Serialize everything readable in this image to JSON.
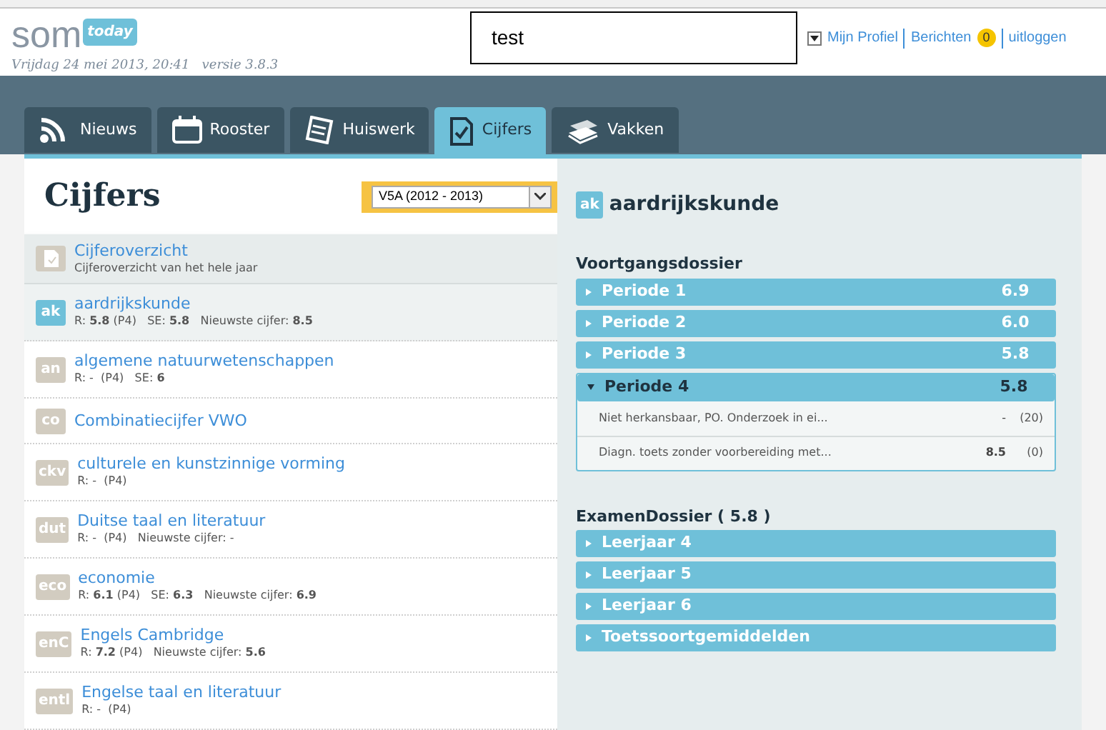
{
  "header": {
    "logo": "som",
    "logo_badge": "today",
    "date": "Vrijdag 24 mei 2013, 20:41",
    "version": "versie 3.8.3",
    "overlay_box": "test",
    "links": [
      {
        "kind": "link",
        "label": "Mijn Profiel"
      },
      {
        "kind": "badge_link",
        "label": "Berichten",
        "badge": "0"
      },
      {
        "kind": "link",
        "label": "uitloggen"
      }
    ]
  },
  "tabs": [
    {
      "label": "Nieuws",
      "kind": "rss",
      "selected": false
    },
    {
      "label": "Rooster",
      "kind": "calendar",
      "selected": false
    },
    {
      "label": "Huiswerk",
      "kind": "notes",
      "selected": false
    },
    {
      "label": "Cijfers",
      "kind": "check",
      "selected": true
    },
    {
      "label": "Vakken",
      "kind": "books",
      "selected": false
    }
  ],
  "left": {
    "title": "Cijfers",
    "year_select": "V5A (2012 - 2013)",
    "overview": {
      "title": "Cijferoverzicht",
      "subtitle": "Cijferoverzicht van het hele jaar"
    },
    "subjects": [
      {
        "code": "ak",
        "name": "aardrijkskunde",
        "meta": "R: **5.8** (P4)   SE: **5.8**   Nieuwste cijfer: **8.5**",
        "selected": true
      },
      {
        "code": "an",
        "name": "algemene natuurwetenschappen",
        "meta": "R: -  (P4)   SE: **6**",
        "selected": false
      },
      {
        "code": "co",
        "name": "Combinatiecijfer VWO",
        "selected": false
      },
      {
        "code": "ckv",
        "name": "culturele en kunstzinnige vorming",
        "meta": "R: -  (P4)",
        "selected": false
      },
      {
        "code": "dut",
        "name": "Duitse taal en literatuur",
        "meta": "R: -  (P4)   Nieuwste cijfer: -",
        "selected": false
      },
      {
        "code": "eco",
        "name": "economie",
        "meta": "R: **6.1** (P4)   SE: **6.3**   Nieuwste cijfer: **6.9**",
        "selected": false
      },
      {
        "code": "enC",
        "name": "Engels Cambridge",
        "meta": "R: **7.2** (P4)   Nieuwste cijfer: **5.6**",
        "selected": false
      },
      {
        "code": "entl",
        "name": "Engelse taal en literatuur",
        "meta": "R: -  (P4)",
        "selected": false
      }
    ]
  },
  "right": {
    "code": "ak",
    "subject": "aardrijkskunde",
    "progress_title": "Voortgangsdossier",
    "periods": [
      {
        "label": "Periode 1",
        "grade": "6.9",
        "expanded": false
      },
      {
        "label": "Periode 2",
        "grade": "6.0",
        "expanded": false
      },
      {
        "label": "Periode 3",
        "grade": "5.8",
        "expanded": false
      },
      {
        "label": "Periode 4",
        "grade": "5.8",
        "expanded": true,
        "rows": [
          {
            "description": "Niet herkansbaar, PO. Onderzoek in ei...",
            "grade": "-",
            "weight": "(20)"
          },
          {
            "description": "Diagn. toets zonder voorbereiding met...",
            "grade": "8.5",
            "weight": "(0)"
          }
        ]
      }
    ],
    "exam_title": "ExamenDossier ( 5.8 )",
    "exam_items": [
      {
        "label": "Leerjaar 4",
        "expanded": false
      },
      {
        "label": "Leerjaar 5",
        "expanded": false
      },
      {
        "label": "Leerjaar 6",
        "expanded": false
      },
      {
        "label": "Toetssoortgemiddelden",
        "expanded": false
      }
    ]
  }
}
